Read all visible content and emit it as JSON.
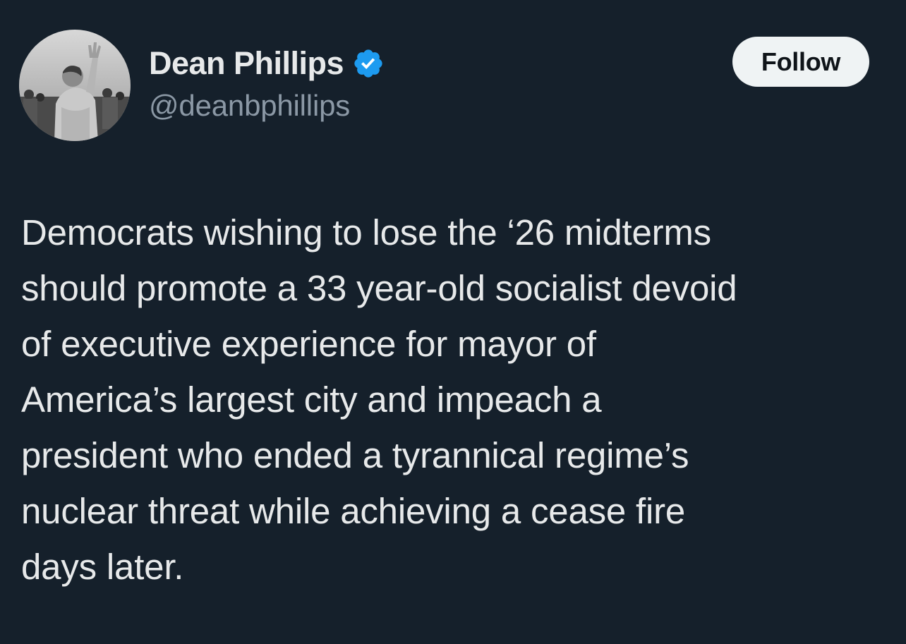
{
  "author": {
    "display_name": "Dean Phillips",
    "handle": "@deanbphillips",
    "avatar_icon": "profile-photo",
    "verified_icon": "verified-badge-icon",
    "verified_color": "#1d9bf0"
  },
  "follow_button": {
    "label": "Follow"
  },
  "tweet": {
    "lines": [
      "Democrats wishing to lose the ‘26 midterms",
      "should promote a 33 year-old socialist devoid",
      "of executive experience for mayor of",
      "America’s largest city and impeach a",
      "president who ended a tyrannical regime’s",
      "nuclear threat while achieving a cease fire",
      "days later."
    ]
  },
  "colors": {
    "background": "#15202b",
    "primary_text": "#e7e9ea",
    "secondary_text": "#8b98a5",
    "button_bg": "#eff3f4",
    "button_text": "#0f1419"
  }
}
